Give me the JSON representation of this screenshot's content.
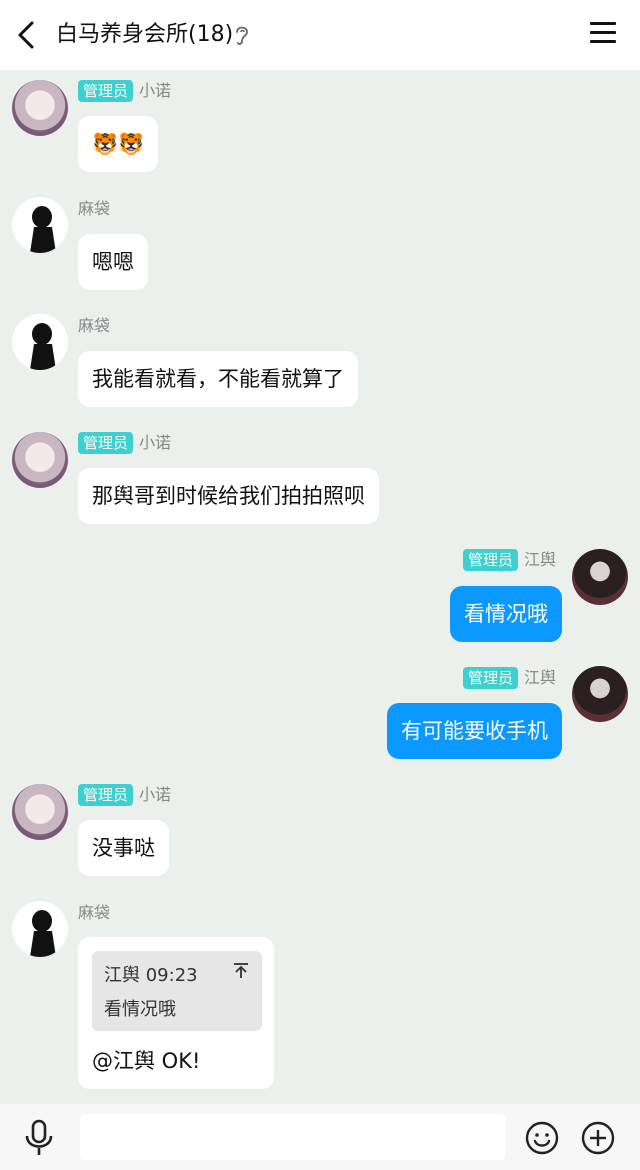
{
  "header": {
    "title": "白马养身会所(18)"
  },
  "badge_text": "管理员",
  "messages": [
    {
      "sender": "小诺",
      "admin": true,
      "text": "🐯🐯"
    },
    {
      "sender": "麻袋",
      "admin": false,
      "text": "嗯嗯"
    },
    {
      "sender": "麻袋",
      "admin": false,
      "text": "我能看就看，不能看就算了"
    },
    {
      "sender": "小诺",
      "admin": true,
      "text": "那舆哥到时候给我们拍拍照呗"
    },
    {
      "sender": "江舆",
      "admin": true,
      "text": "看情况哦",
      "self": true
    },
    {
      "sender": "江舆",
      "admin": true,
      "text": "有可能要收手机",
      "self": true
    },
    {
      "sender": "小诺",
      "admin": true,
      "text": "没事哒"
    },
    {
      "sender": "麻袋",
      "admin": false,
      "quote": {
        "name_time": "江舆 09:23",
        "text": "看情况哦"
      },
      "text": "@江舆 OK!"
    }
  ],
  "input": {
    "placeholder": ""
  },
  "colors": {
    "self_bubble": "#0b99ff",
    "badge": "#3ecfcf",
    "background": "#ecf0ec"
  }
}
